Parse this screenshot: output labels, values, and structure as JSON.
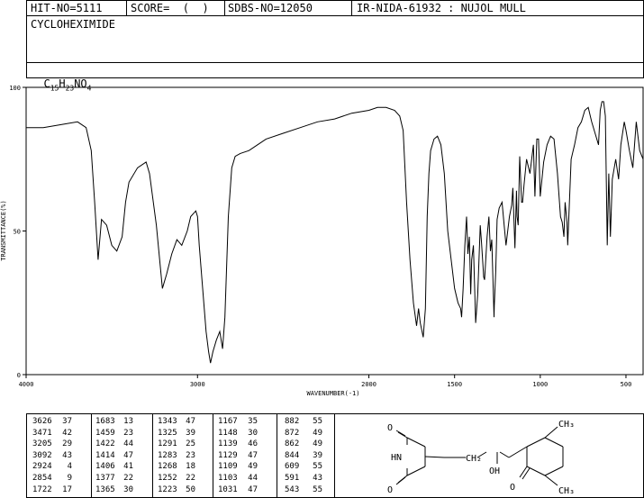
{
  "header": {
    "hit_no": "HIT-NO=5111",
    "score": "SCORE=  (  )",
    "sdbs_no": "SDBS-NO=12050",
    "ir_nida": "IR-NIDA-61932 : NUJOL MULL",
    "compound_name": "CYCLOHEXIMIDE",
    "formula_parts": [
      "C",
      "15",
      "H",
      "23",
      "NO",
      "4"
    ]
  },
  "chart_data": {
    "type": "line",
    "xlabel": "WAVENUMBER(-1)",
    "ylabel": "TRANSMITTANCE(%)",
    "xlim": [
      4000,
      400
    ],
    "ylim": [
      0,
      100
    ],
    "x_ticks": [
      4000,
      3000,
      2000,
      1500,
      1000,
      500
    ],
    "y_ticks": [
      0,
      50,
      100
    ],
    "series": [
      {
        "x": [
          4000,
          3900,
          3800,
          3700,
          3650,
          3620,
          3600,
          3580,
          3560,
          3530,
          3500,
          3471,
          3440,
          3420,
          3400,
          3350,
          3300,
          3280,
          3240,
          3205,
          3180,
          3150,
          3120,
          3092,
          3060,
          3040,
          3010,
          3000,
          2990,
          2970,
          2950,
          2935,
          2924,
          2910,
          2890,
          2870,
          2854,
          2840,
          2820,
          2800,
          2780,
          2750,
          2700,
          2650,
          2600,
          2500,
          2400,
          2300,
          2200,
          2100,
          2000,
          1950,
          1900,
          1850,
          1820,
          1800,
          1780,
          1760,
          1740,
          1722,
          1710,
          1700,
          1683,
          1670,
          1660,
          1650,
          1640,
          1620,
          1600,
          1580,
          1560,
          1540,
          1520,
          1500,
          1480,
          1465,
          1459,
          1450,
          1440,
          1430,
          1422,
          1414,
          1406,
          1400,
          1390,
          1377,
          1365,
          1350,
          1343,
          1330,
          1325,
          1310,
          1300,
          1291,
          1283,
          1270,
          1268,
          1260,
          1252,
          1240,
          1223,
          1200,
          1180,
          1167,
          1160,
          1148,
          1139,
          1135,
          1129,
          1120,
          1109,
          1103,
          1095,
          1080,
          1060,
          1040,
          1031,
          1020,
          1010,
          1000,
          980,
          960,
          940,
          920,
          900,
          882,
          872,
          862,
          855,
          844,
          840,
          820,
          800,
          780,
          760,
          740,
          720,
          700,
          680,
          660,
          650,
          640,
          630,
          620,
          609,
          600,
          591,
          580,
          560,
          543,
          530,
          510,
          500,
          480,
          460,
          440,
          420,
          400
        ],
        "y": [
          86,
          86,
          87,
          88,
          86,
          78,
          60,
          40,
          54,
          52,
          45,
          43,
          48,
          60,
          67,
          72,
          74,
          70,
          52,
          30,
          35,
          42,
          47,
          45,
          50,
          55,
          57,
          55,
          45,
          30,
          15,
          8,
          4,
          8,
          12,
          15,
          9,
          20,
          55,
          72,
          76,
          77,
          78,
          80,
          82,
          84,
          86,
          88,
          89,
          91,
          92,
          93,
          93,
          92,
          90,
          85,
          60,
          40,
          25,
          17,
          23,
          18,
          13,
          23,
          55,
          70,
          78,
          82,
          83,
          80,
          70,
          50,
          40,
          30,
          25,
          23,
          20,
          30,
          45,
          55,
          42,
          48,
          28,
          40,
          45,
          18,
          28,
          52,
          46,
          34,
          33,
          48,
          55,
          43,
          47,
          20,
          24,
          36,
          54,
          58,
          60,
          45,
          55,
          59,
          65,
          44,
          64,
          55,
          52,
          76,
          60,
          60,
          66,
          75,
          70,
          80,
          62,
          82,
          82,
          62,
          74,
          80,
          83,
          82,
          70,
          55,
          53,
          48,
          60,
          53,
          45,
          75,
          80,
          86,
          88,
          92,
          93,
          88,
          84,
          80,
          92,
          95,
          95,
          90,
          45,
          70,
          48,
          68,
          75,
          68,
          80,
          88,
          85,
          78,
          72,
          88,
          78,
          75
        ]
      }
    ],
    "grid": false
  },
  "peaks": [
    [
      "3626",
      "37",
      "1683",
      "13",
      "1343",
      "47",
      "1167",
      "35",
      "882",
      "55"
    ],
    [
      "3471",
      "42",
      "1459",
      "23",
      "1325",
      "39",
      "1148",
      "30",
      "872",
      "49"
    ],
    [
      "3205",
      "29",
      "1422",
      "44",
      "1291",
      "25",
      "1139",
      "46",
      "862",
      "49"
    ],
    [
      "3092",
      "43",
      "1414",
      "47",
      "1283",
      "23",
      "1129",
      "47",
      "844",
      "39"
    ],
    [
      "2924",
      "4",
      "1406",
      "41",
      "1268",
      "18",
      "1109",
      "49",
      "609",
      "55"
    ],
    [
      "2854",
      "9",
      "1377",
      "22",
      "1252",
      "22",
      "1103",
      "44",
      "591",
      "43"
    ],
    [
      "1722",
      "17",
      "1365",
      "30",
      "1223",
      "50",
      "1031",
      "47",
      "543",
      "55"
    ]
  ],
  "structure_labels": {
    "o1": "O",
    "hn": "HN",
    "o2": "O",
    "ch2": "CH₂",
    "oh": "OH",
    "o3": "O",
    "ch3_top": "CH₃",
    "ch3_bottom": "CH₃"
  }
}
